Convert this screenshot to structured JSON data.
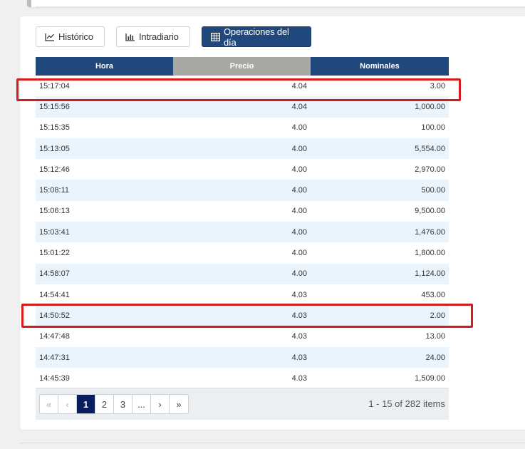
{
  "tabs": [
    {
      "label": "Histórico",
      "icon": "line-chart-icon"
    },
    {
      "label": "Intradiario",
      "icon": "bar-chart-icon"
    },
    {
      "label": "Operaciones del día",
      "icon": "table-icon"
    }
  ],
  "table": {
    "headers": [
      "Hora",
      "Precio",
      "Nominales"
    ],
    "rows": [
      [
        "15:17:04",
        "4.04",
        "3.00"
      ],
      [
        "15:15:56",
        "4.04",
        "1,000.00"
      ],
      [
        "15:15:35",
        "4.00",
        "100.00"
      ],
      [
        "15:13:05",
        "4.00",
        "5,554.00"
      ],
      [
        "15:12:46",
        "4.00",
        "2,970.00"
      ],
      [
        "15:08:11",
        "4.00",
        "500.00"
      ],
      [
        "15:06:13",
        "4.00",
        "9,500.00"
      ],
      [
        "15:03:41",
        "4.00",
        "1,476.00"
      ],
      [
        "15:01:22",
        "4.00",
        "1,800.00"
      ],
      [
        "14:58:07",
        "4.00",
        "1,124.00"
      ],
      [
        "14:54:41",
        "4.03",
        "453.00"
      ],
      [
        "14:50:52",
        "4.03",
        "2.00"
      ],
      [
        "14:47:48",
        "4.03",
        "13.00"
      ],
      [
        "14:47:31",
        "4.03",
        "24.00"
      ],
      [
        "14:45:39",
        "4.03",
        "1,509.00"
      ]
    ]
  },
  "pager": {
    "first": "«",
    "prev": "‹",
    "pages": [
      "1",
      "2",
      "3",
      "..."
    ],
    "next": "›",
    "last": "»",
    "info": "1 - 15 of 282 items"
  },
  "colors": {
    "header": "#21487c",
    "sorted_header": "#a8a8a4",
    "row_alt": "#e9f4fd",
    "highlight": "#d51b1b"
  }
}
